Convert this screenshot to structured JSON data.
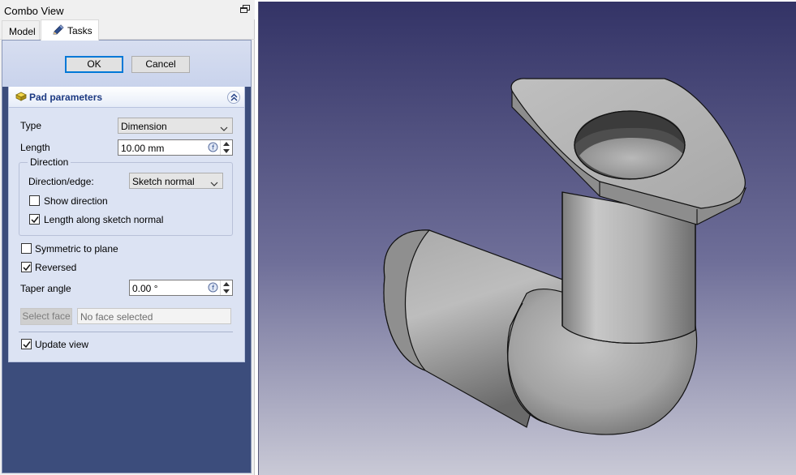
{
  "combo_view": {
    "title": "Combo View",
    "float_icon": "float-window-icon",
    "tabs": [
      {
        "label": "Model",
        "active": false
      },
      {
        "label": "Tasks",
        "active": true,
        "icon": "pencil-icon"
      }
    ]
  },
  "dialog_buttons": {
    "ok_label": "OK",
    "cancel_label": "Cancel"
  },
  "pad_parameters": {
    "title": "Pad parameters",
    "icon": "pad-feature-icon",
    "collapse_icon": "collapse-chevron-icon",
    "type": {
      "label": "Type",
      "value": "Dimension"
    },
    "length": {
      "label": "Length",
      "value": "10.00 mm"
    },
    "direction_group": {
      "title": "Direction",
      "direction_edge": {
        "label": "Direction/edge:",
        "value": "Sketch normal"
      },
      "show_direction": {
        "label": "Show direction",
        "checked": false
      },
      "length_along_normal": {
        "label": "Length along sketch normal",
        "checked": true
      }
    },
    "symmetric": {
      "label": "Symmetric to plane",
      "checked": false
    },
    "reversed": {
      "label": "Reversed",
      "checked": true
    },
    "taper_angle": {
      "label": "Taper angle",
      "value": "0.00 °"
    },
    "select_face": {
      "button_label": "Select face",
      "placeholder": "No face selected"
    },
    "update_view": {
      "label": "Update view",
      "checked": true
    }
  },
  "viewport": {
    "background_top": "#333366",
    "background_bottom": "#c9c9d6",
    "model_fill": "#b4b4b4"
  }
}
